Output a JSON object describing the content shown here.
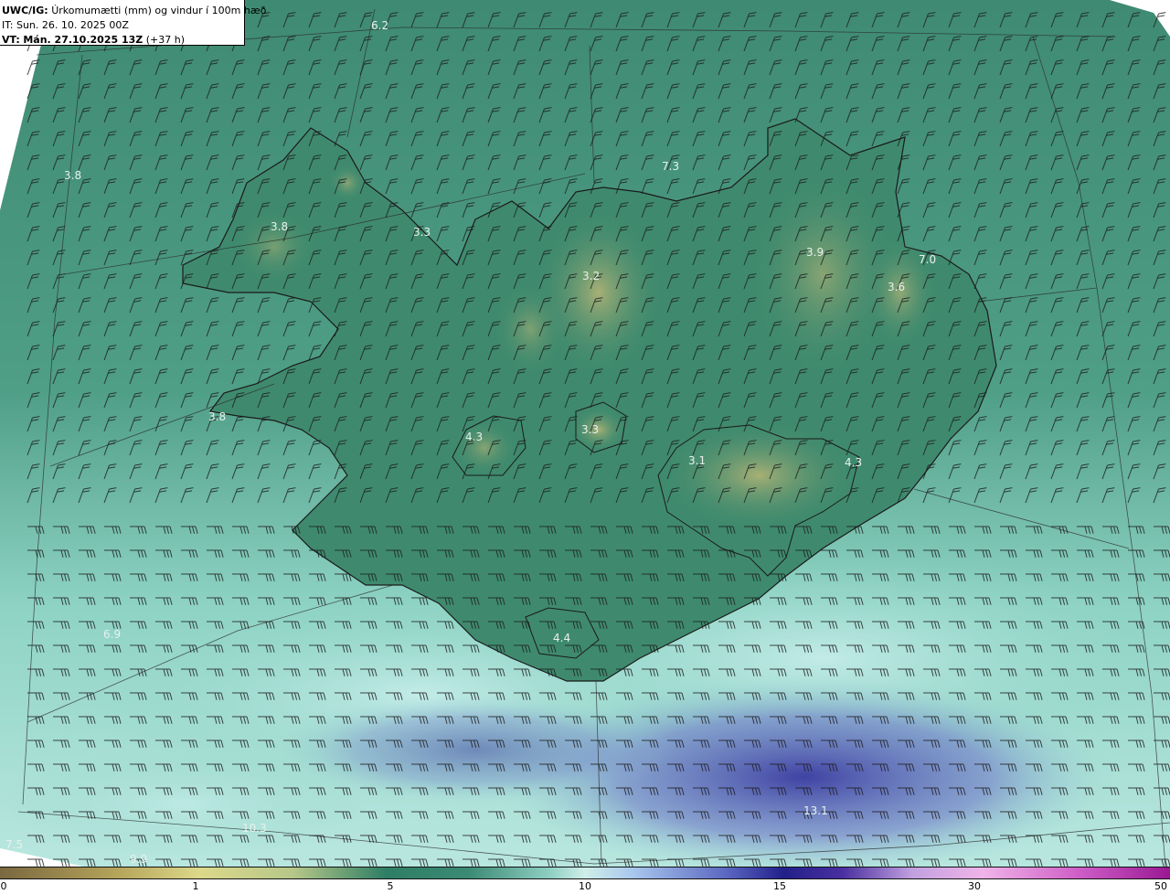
{
  "header": {
    "model": "UWC/IG:",
    "title": "Úrkomumætti (mm) og vindur í 100m hæð",
    "init_time": "IT: Sun. 26. 10. 2025 00Z",
    "valid_prefix": "VT:",
    "valid_time": "Mán. 27.10.2025 13Z",
    "lead": "(+37 h)"
  },
  "colorbar": {
    "ticks": [
      "0",
      "1",
      "5",
      "10",
      "15",
      "30",
      "50"
    ],
    "stops": [
      {
        "at": 0.0,
        "color": "#7a6840"
      },
      {
        "at": 0.1,
        "color": "#b5a45a"
      },
      {
        "at": 0.17,
        "color": "#dcd88a"
      },
      {
        "at": 0.25,
        "color": "#b7c889"
      },
      {
        "at": 0.33,
        "color": "#2e7e65"
      },
      {
        "at": 0.4,
        "color": "#3b8a74"
      },
      {
        "at": 0.47,
        "color": "#8fcfc2"
      },
      {
        "at": 0.5,
        "color": "#cfeee8"
      },
      {
        "at": 0.54,
        "color": "#a9c8ee"
      },
      {
        "at": 0.62,
        "color": "#5c68c2"
      },
      {
        "at": 0.67,
        "color": "#22208a"
      },
      {
        "at": 0.72,
        "color": "#4a2fa0"
      },
      {
        "at": 0.78,
        "color": "#c2a0e0"
      },
      {
        "at": 0.84,
        "color": "#f0b4e8"
      },
      {
        "at": 0.92,
        "color": "#d060c8"
      },
      {
        "at": 1.0,
        "color": "#9a1894"
      }
    ]
  },
  "map": {
    "ocean_color": "#4a9a82",
    "land_color": "#3f8a6e",
    "highland_color": "#a7ae6e",
    "high_precip_color": "#4e52b0",
    "coastline_color": "#1a1a1a",
    "barb_color": "#1c1c1c",
    "values": [
      {
        "text": "6.2"
      },
      {
        "text": "7.3"
      },
      {
        "text": "3.8"
      },
      {
        "text": "3.8"
      },
      {
        "text": "3.3"
      },
      {
        "text": "3.2"
      },
      {
        "text": "3.9"
      },
      {
        "text": "3.6"
      },
      {
        "text": "7.0"
      },
      {
        "text": "3.8"
      },
      {
        "text": "4.3"
      },
      {
        "text": "3.3"
      },
      {
        "text": "3.1"
      },
      {
        "text": "4.3"
      },
      {
        "text": "6.9"
      },
      {
        "text": "4.4"
      },
      {
        "text": "10.3"
      },
      {
        "text": "13.1"
      },
      {
        "text": "7.5"
      },
      {
        "text": "9.9"
      }
    ]
  }
}
